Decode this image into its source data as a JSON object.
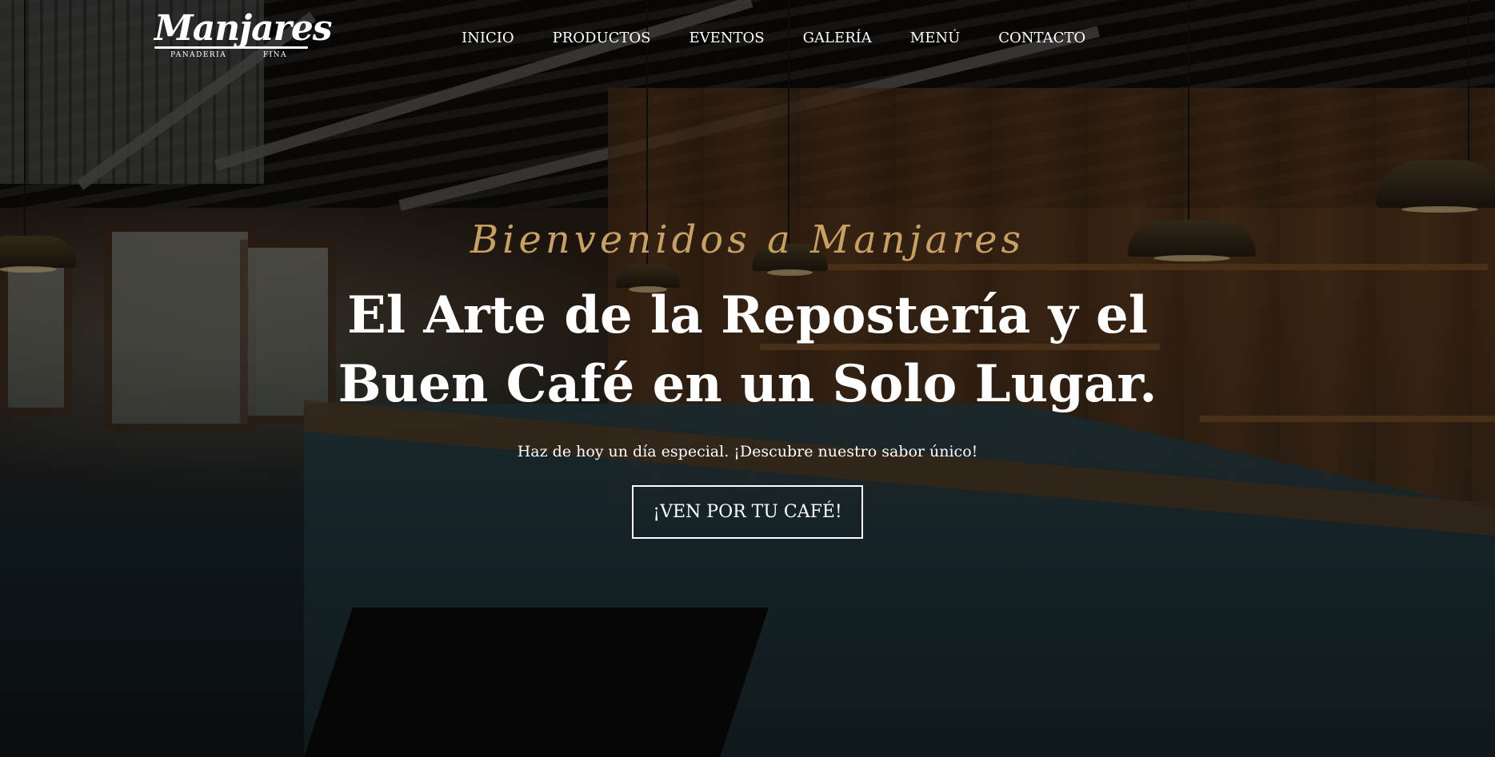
{
  "brand": {
    "logo_word": "Manjares",
    "logo_sub_left": "PANADERIA",
    "logo_sub_right": "FINA"
  },
  "nav": {
    "items": [
      {
        "label": "INICIO"
      },
      {
        "label": "PRODUCTOS"
      },
      {
        "label": "EVENTOS"
      },
      {
        "label": "GALERÍA"
      },
      {
        "label": "MENÚ"
      },
      {
        "label": "CONTACTO"
      }
    ]
  },
  "hero": {
    "welcome": "Bienvenidos a Manjares",
    "headline_line1": "El Arte de la Repostería y el",
    "headline_line2": "Buen Café en un Solo Lugar.",
    "tagline": "Haz de hoy un día especial. ¡Descubre nuestro sabor único!",
    "cta_label": "¡VEN POR TU CAFÉ!"
  },
  "colors": {
    "accent_gold": "#c9a063",
    "text_white": "#ffffff"
  }
}
